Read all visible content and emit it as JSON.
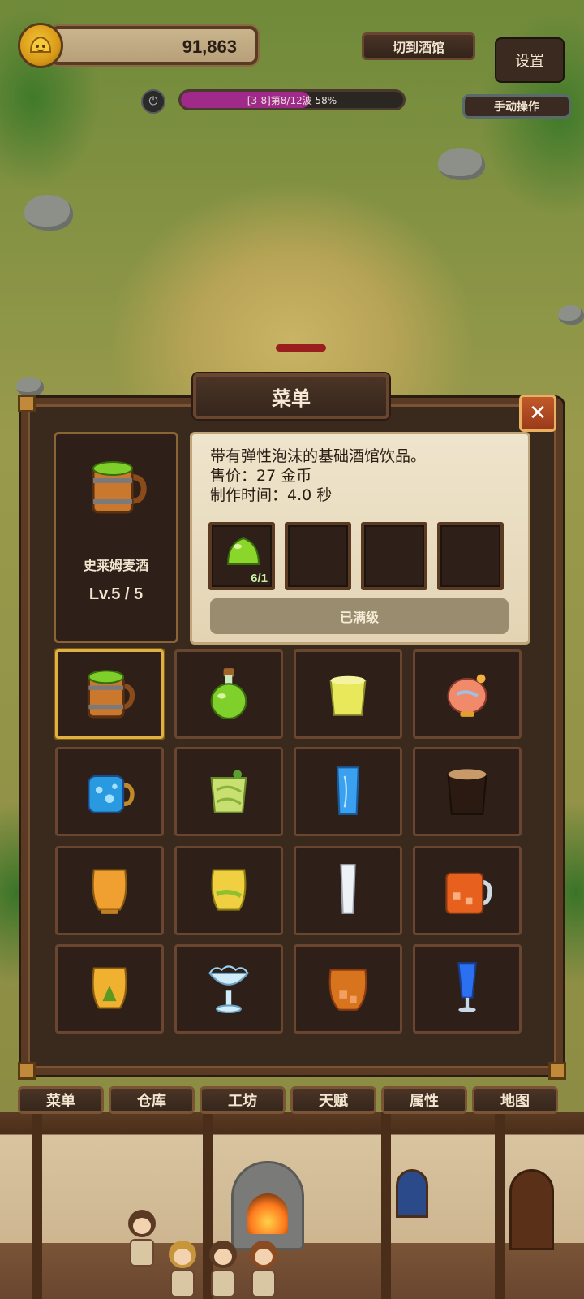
{
  "hud": {
    "coins": "91,863",
    "switch_label": "切到酒馆",
    "settings_label": "设置",
    "manual_label": "手动操作",
    "wave_text": "[3-8]第8/12波  58%",
    "wave_progress_percent": 58
  },
  "menu": {
    "title": "菜单",
    "close_label": "✕",
    "selected_item": {
      "name": "史莱姆麦酒",
      "level": "Lv.5 / 5",
      "icon": "slime-ale-mug-icon"
    },
    "info": {
      "description": "带有弹性泡沫的基础酒馆饮品。",
      "price": "售价：27 金币",
      "craft_time": "制作时间：4.0 秒",
      "ingredients": [
        {
          "icon": "green-slime-icon",
          "count": "6/1"
        },
        {
          "icon": "empty-slot",
          "count": ""
        },
        {
          "icon": "empty-slot",
          "count": ""
        },
        {
          "icon": "empty-slot",
          "count": ""
        }
      ],
      "maxed_label": "已满级"
    },
    "drinks": [
      {
        "icon": "slime-ale-mug-icon"
      },
      {
        "icon": "green-potion-flask-icon"
      },
      {
        "icon": "lemon-drink-glass-icon"
      },
      {
        "icon": "peach-cocktail-icon"
      },
      {
        "icon": "blue-bubble-mug-icon"
      },
      {
        "icon": "mint-smoothie-icon"
      },
      {
        "icon": "blue-soda-glass-icon"
      },
      {
        "icon": "dark-stout-glass-icon"
      },
      {
        "icon": "amber-whiskey-glass-icon"
      },
      {
        "icon": "yellow-juice-glass-icon"
      },
      {
        "icon": "milk-glass-icon"
      },
      {
        "icon": "ice-tea-mug-icon"
      },
      {
        "icon": "herbal-brandy-glass-icon"
      },
      {
        "icon": "frost-goblet-icon"
      },
      {
        "icon": "iced-amber-glass-icon"
      },
      {
        "icon": "blue-tall-cocktail-icon"
      }
    ]
  },
  "nav": {
    "tabs": [
      "菜单",
      "仓库",
      "工坊",
      "天赋",
      "属性",
      "地图"
    ]
  },
  "colors": {
    "accent_gold": "#e0b040",
    "progress_magenta": "#a02a8a",
    "panel_brown": "#3a2a1e",
    "close_red": "#c05a2a"
  }
}
